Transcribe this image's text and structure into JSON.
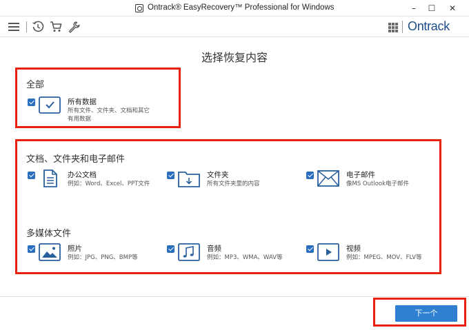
{
  "window": {
    "title": "Ontrack® EasyRecovery™ Professional for Windows",
    "minimize_glyph": "–",
    "maximize_glyph": "☐",
    "close_glyph": "✕"
  },
  "toolbar": {
    "icons": [
      "menu-icon",
      "history-icon",
      "cart-icon",
      "wrench-icon"
    ],
    "brand": "Ontrack"
  },
  "page": {
    "title": "选择恢复内容"
  },
  "sections": {
    "all": {
      "title": "全部",
      "items": [
        {
          "icon": "checkmark-box-icon",
          "label": "所有数据",
          "desc_line1": "所有文件、文件夹、文档和其它",
          "desc_line2": "有用数据",
          "checked": true
        }
      ]
    },
    "documents": {
      "title": "文档、文件夹和电子邮件",
      "items": [
        {
          "icon": "document-icon",
          "label": "办公文档",
          "desc": "例如：Word、Excel、PPT文件",
          "checked": true
        },
        {
          "icon": "folder-icon",
          "label": "文件夹",
          "desc": "所有文件夹里的内容",
          "checked": true
        },
        {
          "icon": "email-icon",
          "label": "电子邮件",
          "desc": "像MS Outlook电子邮件",
          "checked": true
        }
      ]
    },
    "multimedia": {
      "title": "多媒体文件",
      "items": [
        {
          "icon": "photo-icon",
          "label": "照片",
          "desc": "例如：JPG、PNG、BMP等",
          "checked": true
        },
        {
          "icon": "music-icon",
          "label": "音频",
          "desc": "例如：MP3、WMA、WAV等",
          "checked": true
        },
        {
          "icon": "video-icon",
          "label": "视频",
          "desc": "例如：MPEG、MOV、FLV等",
          "checked": true
        }
      ]
    }
  },
  "footer": {
    "next_label": "下一个"
  },
  "colors": {
    "accent": "#2f80d1",
    "checkbox": "#2a6fbd",
    "brand": "#1e4e89",
    "highlight": "#e8200d"
  }
}
